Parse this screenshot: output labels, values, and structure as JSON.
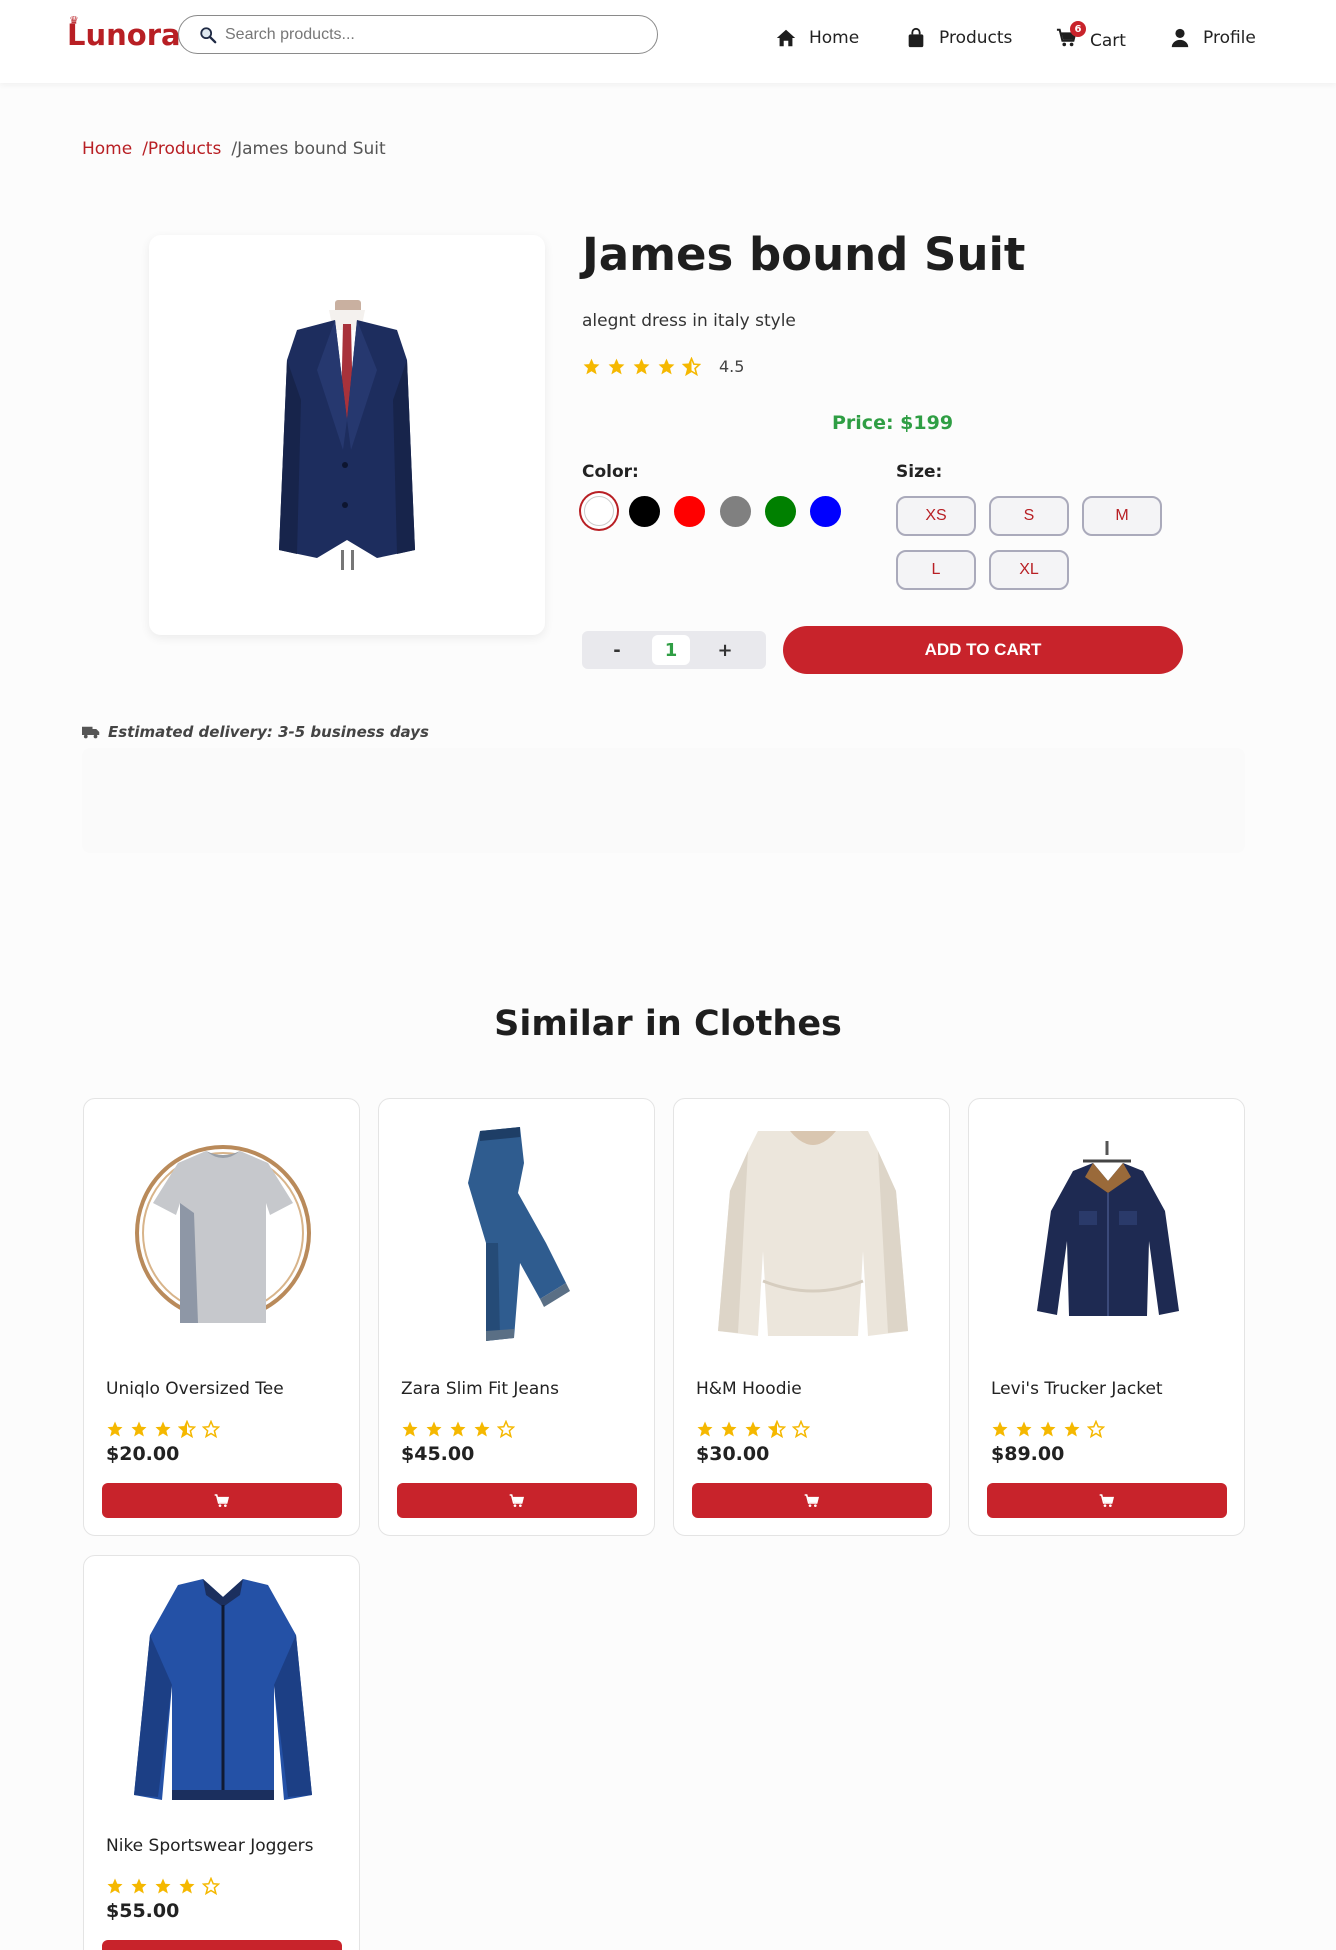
{
  "header": {
    "logo": "Lunora",
    "search_placeholder": "Search products...",
    "nav": {
      "home": "Home",
      "products": "Products",
      "cart": "Cart",
      "cart_count": "6",
      "profile": "Profile"
    }
  },
  "breadcrumb": {
    "home": "Home",
    "products": "/Products",
    "current": "/James bound Suit"
  },
  "product": {
    "title": "James bound Suit",
    "description": "alegnt dress in italy style",
    "rating": "4.5",
    "rating_value": 4.5,
    "price": "Price: $199",
    "color_label": "Color:",
    "colors": [
      "#ffffff",
      "#000000",
      "#ff0000",
      "#808080",
      "#008000",
      "#0000ff"
    ],
    "selected_color": "#ffffff",
    "size_label": "Size:",
    "sizes": [
      "XS",
      "S",
      "M",
      "L",
      "XL"
    ],
    "quantity": "1",
    "qty_minus": "-",
    "qty_plus": "+",
    "add_to_cart": "ADD TO CART",
    "delivery": "Estimated delivery: 3-5 business days"
  },
  "similar": {
    "title": "Similar in Clothes",
    "items": [
      {
        "name": "Uniqlo Oversized Tee",
        "price": "$20.00",
        "rating": 3.5
      },
      {
        "name": "Zara Slim Fit Jeans",
        "price": "$45.00",
        "rating": 4
      },
      {
        "name": "H&M Hoodie",
        "price": "$30.00",
        "rating": 3.5
      },
      {
        "name": "Levi's Trucker Jacket",
        "price": "$89.00",
        "rating": 4
      },
      {
        "name": "Nike Sportswear Joggers",
        "price": "$55.00",
        "rating": 4
      }
    ]
  },
  "colors": {
    "accent": "#c8232b",
    "price_green": "#2f9e44",
    "star": "#f5b800"
  }
}
